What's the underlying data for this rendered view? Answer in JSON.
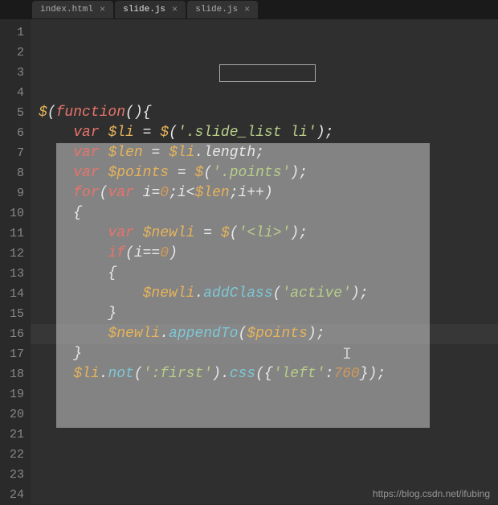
{
  "tabs": [
    {
      "label": "index.html",
      "active": false
    },
    {
      "label": "slide.js",
      "active": true
    },
    {
      "label": "slide.js",
      "active": false
    }
  ],
  "lines": [
    {
      "n": 1,
      "html": "<span class='var'>$</span><span class='white'>(</span><span class='kw'>function</span><span class='white'>(){</span>"
    },
    {
      "n": 2,
      "html": ""
    },
    {
      "n": 3,
      "html": "    <span class='kw'>var</span> <span class='var'>$li</span> <span class='white'>=</span> <span class='var'>$</span><span class='white'>(</span><span class='str'>'.slide_list li'</span><span class='white'>);</span>"
    },
    {
      "n": 4,
      "html": "    <span class='kw'>var</span> <span class='var'>$len</span> <span class='white'>=</span> <span class='var'>$li</span><span class='white'>.</span><span class='white'>length</span><span class='white'>;</span>"
    },
    {
      "n": 5,
      "html": "    <span class='kw'>var</span> <span class='var'>$points</span> <span class='white'>=</span> <span class='var'>$</span><span class='white'>(</span><span class='str'>'.points'</span><span class='white'>);</span>"
    },
    {
      "n": 6,
      "html": ""
    },
    {
      "n": 7,
      "html": "    <span class='kw'>for</span><span class='white'>(</span><span class='kw'>var</span> <span class='white'>i</span><span class='white'>=</span><span class='num'>0</span><span class='white'>;i&lt;</span><span class='var'>$len</span><span class='white'>;i++)</span>"
    },
    {
      "n": 8,
      "html": "    <span class='white'>{</span>"
    },
    {
      "n": 9,
      "html": "        <span class='kw'>var</span> <span class='var'>$newli</span> <span class='white'>=</span> <span class='var'>$</span><span class='white'>(</span><span class='str'>'&lt;li&gt;'</span><span class='white'>);</span>"
    },
    {
      "n": 10,
      "html": ""
    },
    {
      "n": 11,
      "html": "        <span class='kw'>if</span><span class='white'>(i==</span><span class='num'>0</span><span class='white'>)</span>"
    },
    {
      "n": 12,
      "html": "        <span class='white'>{</span>"
    },
    {
      "n": 13,
      "html": "            <span class='var'>$newli</span><span class='white'>.</span><span class='fn'>addClass</span><span class='white'>(</span><span class='str'>'active'</span><span class='white'>);</span>"
    },
    {
      "n": 14,
      "html": "        <span class='white'>}</span>"
    },
    {
      "n": 15,
      "html": ""
    },
    {
      "n": 16,
      "html": "        <span class='var'>$newli</span><span class='white'>.</span><span class='fn'>appendTo</span><span class='white'>(</span><span class='var'>$points</span><span class='white'>);</span>"
    },
    {
      "n": 17,
      "html": ""
    },
    {
      "n": 18,
      "html": ""
    },
    {
      "n": 19,
      "html": ""
    },
    {
      "n": 20,
      "html": "    <span class='white'>}</span>"
    },
    {
      "n": 21,
      "html": ""
    },
    {
      "n": 22,
      "html": ""
    },
    {
      "n": 23,
      "html": "    <span class='var'>$li</span><span class='white'>.</span><span class='fn'>not</span><span class='white'>(</span><span class='str'>':first'</span><span class='white'>).</span><span class='fn'>css</span><span class='white'>({</span><span class='str'>'left'</span><span class='white'>:</span><span class='num'>760</span><span class='white'>});</span>"
    },
    {
      "n": 24,
      "html": ""
    }
  ],
  "watermark": "https://blog.csdn.net/ifubing",
  "icons": {
    "close": "×",
    "cursor": "I"
  }
}
